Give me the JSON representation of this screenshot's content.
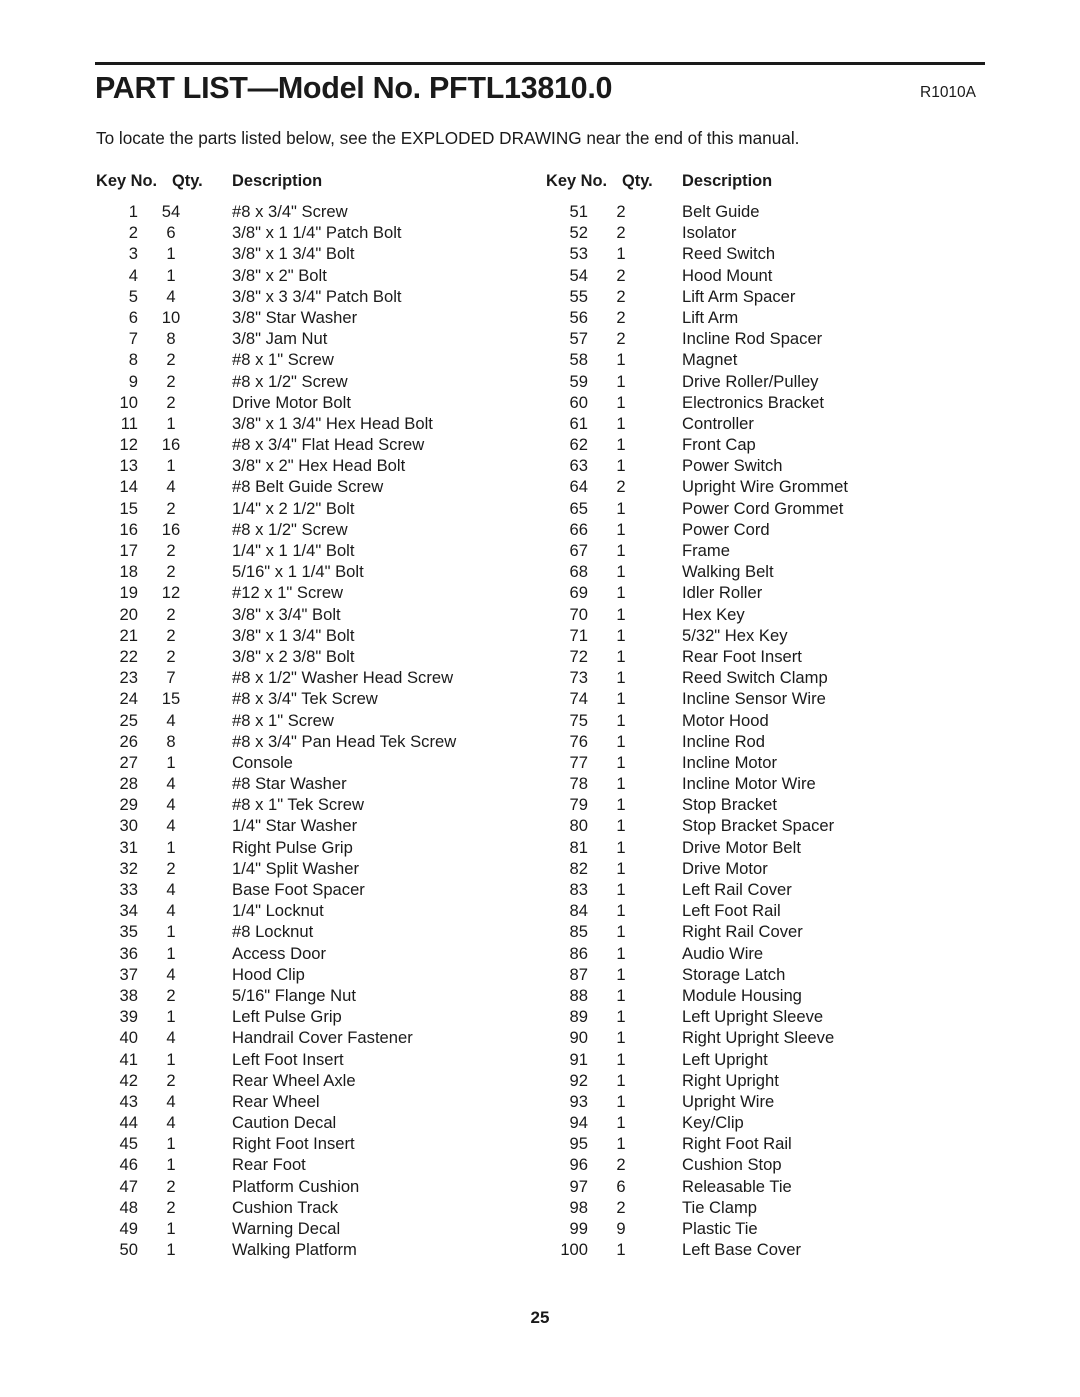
{
  "document": {
    "title": "PART LIST—Model No. PFTL13810.0",
    "revision_code": "R1010A",
    "intro_text": "To locate the parts listed below, see the EXPLODED DRAWING near the end of this manual.",
    "page_number": "25"
  },
  "table": {
    "headers": {
      "key_no": "Key No.",
      "qty": "Qty.",
      "description": "Description"
    },
    "left_column": [
      {
        "key": "1",
        "qty": "54",
        "description": "#8 x 3/4\" Screw"
      },
      {
        "key": "2",
        "qty": "6",
        "description": "3/8\" x 1 1/4\" Patch Bolt"
      },
      {
        "key": "3",
        "qty": "1",
        "description": "3/8\" x 1 3/4\" Bolt"
      },
      {
        "key": "4",
        "qty": "1",
        "description": "3/8\" x 2\" Bolt"
      },
      {
        "key": "5",
        "qty": "4",
        "description": "3/8\" x 3 3/4\" Patch Bolt"
      },
      {
        "key": "6",
        "qty": "10",
        "description": "3/8\" Star Washer"
      },
      {
        "key": "7",
        "qty": "8",
        "description": "3/8\" Jam Nut"
      },
      {
        "key": "8",
        "qty": "2",
        "description": "#8 x 1\" Screw"
      },
      {
        "key": "9",
        "qty": "2",
        "description": "#8 x 1/2\" Screw"
      },
      {
        "key": "10",
        "qty": "2",
        "description": "Drive Motor Bolt"
      },
      {
        "key": "11",
        "qty": "1",
        "description": "3/8\" x 1 3/4\" Hex Head Bolt"
      },
      {
        "key": "12",
        "qty": "16",
        "description": "#8 x 3/4\" Flat Head Screw"
      },
      {
        "key": "13",
        "qty": "1",
        "description": "3/8\" x 2\" Hex Head Bolt"
      },
      {
        "key": "14",
        "qty": "4",
        "description": "#8 Belt Guide Screw"
      },
      {
        "key": "15",
        "qty": "2",
        "description": "1/4\" x 2 1/2\" Bolt"
      },
      {
        "key": "16",
        "qty": "16",
        "description": "#8 x 1/2\" Screw"
      },
      {
        "key": "17",
        "qty": "2",
        "description": "1/4\" x 1 1/4\" Bolt"
      },
      {
        "key": "18",
        "qty": "2",
        "description": "5/16\" x 1 1/4\" Bolt"
      },
      {
        "key": "19",
        "qty": "12",
        "description": "#12 x 1\" Screw"
      },
      {
        "key": "20",
        "qty": "2",
        "description": "3/8\" x 3/4\" Bolt"
      },
      {
        "key": "21",
        "qty": "2",
        "description": "3/8\" x 1 3/4\" Bolt"
      },
      {
        "key": "22",
        "qty": "2",
        "description": "3/8\" x 2 3/8\" Bolt"
      },
      {
        "key": "23",
        "qty": "7",
        "description": "#8 x 1/2\" Washer Head Screw"
      },
      {
        "key": "24",
        "qty": "15",
        "description": "#8 x 3/4\" Tek Screw"
      },
      {
        "key": "25",
        "qty": "4",
        "description": "#8 x 1\" Screw"
      },
      {
        "key": "26",
        "qty": "8",
        "description": "#8 x 3/4\" Pan Head Tek Screw"
      },
      {
        "key": "27",
        "qty": "1",
        "description": "Console"
      },
      {
        "key": "28",
        "qty": "4",
        "description": "#8 Star Washer"
      },
      {
        "key": "29",
        "qty": "4",
        "description": "#8 x 1\" Tek Screw"
      },
      {
        "key": "30",
        "qty": "4",
        "description": "1/4\" Star Washer"
      },
      {
        "key": "31",
        "qty": "1",
        "description": "Right Pulse Grip"
      },
      {
        "key": "32",
        "qty": "2",
        "description": "1/4\" Split Washer"
      },
      {
        "key": "33",
        "qty": "4",
        "description": "Base Foot Spacer"
      },
      {
        "key": "34",
        "qty": "4",
        "description": "1/4\" Locknut"
      },
      {
        "key": "35",
        "qty": "1",
        "description": "#8 Locknut"
      },
      {
        "key": "36",
        "qty": "1",
        "description": "Access Door"
      },
      {
        "key": "37",
        "qty": "4",
        "description": "Hood Clip"
      },
      {
        "key": "38",
        "qty": "2",
        "description": "5/16\" Flange Nut"
      },
      {
        "key": "39",
        "qty": "1",
        "description": "Left Pulse Grip"
      },
      {
        "key": "40",
        "qty": "4",
        "description": "Handrail Cover Fastener"
      },
      {
        "key": "41",
        "qty": "1",
        "description": "Left Foot Insert"
      },
      {
        "key": "42",
        "qty": "2",
        "description": "Rear Wheel Axle"
      },
      {
        "key": "43",
        "qty": "4",
        "description": "Rear Wheel"
      },
      {
        "key": "44",
        "qty": "4",
        "description": "Caution Decal"
      },
      {
        "key": "45",
        "qty": "1",
        "description": "Right Foot Insert"
      },
      {
        "key": "46",
        "qty": "1",
        "description": "Rear Foot"
      },
      {
        "key": "47",
        "qty": "2",
        "description": "Platform Cushion"
      },
      {
        "key": "48",
        "qty": "2",
        "description": "Cushion Track"
      },
      {
        "key": "49",
        "qty": "1",
        "description": "Warning Decal"
      },
      {
        "key": "50",
        "qty": "1",
        "description": "Walking Platform"
      }
    ],
    "right_column": [
      {
        "key": "51",
        "qty": "2",
        "description": "Belt Guide"
      },
      {
        "key": "52",
        "qty": "2",
        "description": "Isolator"
      },
      {
        "key": "53",
        "qty": "1",
        "description": "Reed Switch"
      },
      {
        "key": "54",
        "qty": "2",
        "description": "Hood Mount"
      },
      {
        "key": "55",
        "qty": "2",
        "description": "Lift Arm Spacer"
      },
      {
        "key": "56",
        "qty": "2",
        "description": "Lift Arm"
      },
      {
        "key": "57",
        "qty": "2",
        "description": "Incline Rod Spacer"
      },
      {
        "key": "58",
        "qty": "1",
        "description": "Magnet"
      },
      {
        "key": "59",
        "qty": "1",
        "description": "Drive Roller/Pulley"
      },
      {
        "key": "60",
        "qty": "1",
        "description": "Electronics Bracket"
      },
      {
        "key": "61",
        "qty": "1",
        "description": "Controller"
      },
      {
        "key": "62",
        "qty": "1",
        "description": "Front Cap"
      },
      {
        "key": "63",
        "qty": "1",
        "description": "Power Switch"
      },
      {
        "key": "64",
        "qty": "2",
        "description": "Upright Wire Grommet"
      },
      {
        "key": "65",
        "qty": "1",
        "description": "Power Cord Grommet"
      },
      {
        "key": "66",
        "qty": "1",
        "description": "Power Cord"
      },
      {
        "key": "67",
        "qty": "1",
        "description": "Frame"
      },
      {
        "key": "68",
        "qty": "1",
        "description": "Walking Belt"
      },
      {
        "key": "69",
        "qty": "1",
        "description": "Idler Roller"
      },
      {
        "key": "70",
        "qty": "1",
        "description": "Hex Key"
      },
      {
        "key": "71",
        "qty": "1",
        "description": "5/32\" Hex Key"
      },
      {
        "key": "72",
        "qty": "1",
        "description": "Rear Foot Insert"
      },
      {
        "key": "73",
        "qty": "1",
        "description": "Reed Switch Clamp"
      },
      {
        "key": "74",
        "qty": "1",
        "description": "Incline Sensor Wire"
      },
      {
        "key": "75",
        "qty": "1",
        "description": "Motor Hood"
      },
      {
        "key": "76",
        "qty": "1",
        "description": "Incline Rod"
      },
      {
        "key": "77",
        "qty": "1",
        "description": "Incline Motor"
      },
      {
        "key": "78",
        "qty": "1",
        "description": "Incline Motor Wire"
      },
      {
        "key": "79",
        "qty": "1",
        "description": "Stop Bracket"
      },
      {
        "key": "80",
        "qty": "1",
        "description": "Stop Bracket Spacer"
      },
      {
        "key": "81",
        "qty": "1",
        "description": "Drive Motor Belt"
      },
      {
        "key": "82",
        "qty": "1",
        "description": "Drive Motor"
      },
      {
        "key": "83",
        "qty": "1",
        "description": "Left Rail Cover"
      },
      {
        "key": "84",
        "qty": "1",
        "description": "Left Foot Rail"
      },
      {
        "key": "85",
        "qty": "1",
        "description": "Right Rail Cover"
      },
      {
        "key": "86",
        "qty": "1",
        "description": "Audio Wire"
      },
      {
        "key": "87",
        "qty": "1",
        "description": "Storage Latch"
      },
      {
        "key": "88",
        "qty": "1",
        "description": "Module Housing"
      },
      {
        "key": "89",
        "qty": "1",
        "description": "Left Upright Sleeve"
      },
      {
        "key": "90",
        "qty": "1",
        "description": "Right Upright Sleeve"
      },
      {
        "key": "91",
        "qty": "1",
        "description": "Left Upright"
      },
      {
        "key": "92",
        "qty": "1",
        "description": "Right Upright"
      },
      {
        "key": "93",
        "qty": "1",
        "description": "Upright Wire"
      },
      {
        "key": "94",
        "qty": "1",
        "description": "Key/Clip"
      },
      {
        "key": "95",
        "qty": "1",
        "description": "Right Foot Rail"
      },
      {
        "key": "96",
        "qty": "2",
        "description": "Cushion Stop"
      },
      {
        "key": "97",
        "qty": "6",
        "description": "Releasable Tie"
      },
      {
        "key": "98",
        "qty": "2",
        "description": "Tie Clamp"
      },
      {
        "key": "99",
        "qty": "9",
        "description": "Plastic Tie"
      },
      {
        "key": "100",
        "qty": "1",
        "description": "Left Base Cover"
      }
    ]
  }
}
